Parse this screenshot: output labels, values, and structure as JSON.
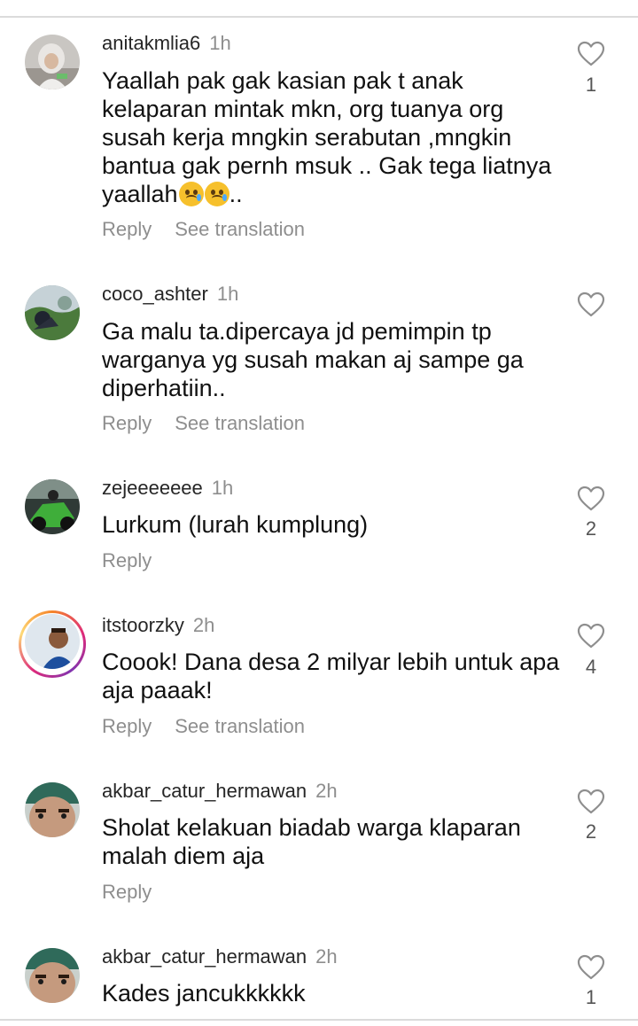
{
  "comments": [
    {
      "username": "anitakmlia6",
      "time": "1h",
      "text": "Yaallah pak gak kasian pak t anak kelaparan mintak mkn, org tuanya org susah kerja mngkin serabutan ,mngkin bantua gak pernh msuk .. Gak tega liatnya yaallah",
      "text_suffix": "..",
      "reply_label": "Reply",
      "translate_label": "See translation",
      "likes": "1",
      "avatar_icon": "profile-photo"
    },
    {
      "username": "coco_ashter",
      "time": "1h",
      "text": "Ga malu ta.dipercaya jd pemimpin tp warganya yg susah makan aj sampe ga diperhatiin..",
      "reply_label": "Reply",
      "translate_label": "See translation",
      "likes": "",
      "avatar_icon": "profile-photo"
    },
    {
      "username": "zejeeeeeee",
      "time": "1h",
      "text": "Lurkum (lurah kumplung)",
      "reply_label": "Reply",
      "likes": "2",
      "avatar_icon": "profile-photo"
    },
    {
      "username": "itstoorzky",
      "time": "2h",
      "text": "Coook! Dana desa 2 milyar lebih untuk apa aja paaak!",
      "reply_label": "Reply",
      "translate_label": "See translation",
      "likes": "4",
      "avatar_icon": "profile-photo",
      "story_ring": true
    },
    {
      "username": "akbar_catur_hermawan",
      "time": "2h",
      "text": "Sholat kelakuan biadab warga klaparan malah diem aja",
      "reply_label": "Reply",
      "likes": "2",
      "avatar_icon": "profile-photo"
    },
    {
      "username": "akbar_catur_hermawan",
      "time": "2h",
      "text": "Kades jancukkkkkk",
      "likes": "1",
      "avatar_icon": "profile-photo"
    }
  ],
  "icons": {
    "like": "heart-outline-icon",
    "emoji": "crying-face-emoji"
  },
  "colors": {
    "secondary_text": "#8e8e8e",
    "divider": "#dbdbdb",
    "story_ring": "#dd2a7b"
  }
}
